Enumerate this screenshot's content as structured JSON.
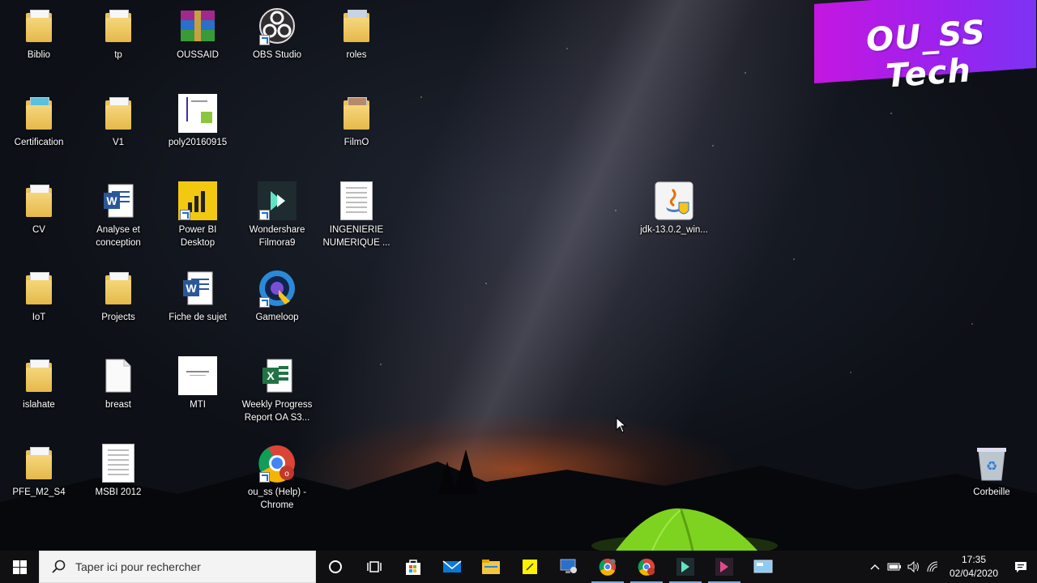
{
  "banner": {
    "text": "OU_SS Tech",
    "color_start": "#c417e0",
    "color_end": "#7c33f5"
  },
  "desktop": {
    "icons": [
      {
        "id": "biblio",
        "label": "Biblio",
        "type": "folder"
      },
      {
        "id": "certification",
        "label": "Certification",
        "type": "folder"
      },
      {
        "id": "cv",
        "label": "CV",
        "type": "folder"
      },
      {
        "id": "iot",
        "label": "IoT",
        "type": "folder"
      },
      {
        "id": "islahate",
        "label": "islahate",
        "type": "folder"
      },
      {
        "id": "pfe",
        "label": "PFE_M2_S4",
        "type": "folder"
      },
      {
        "id": "tp",
        "label": "tp",
        "type": "folder"
      },
      {
        "id": "v1",
        "label": "V1",
        "type": "folder"
      },
      {
        "id": "analyse",
        "label": "Analyse et conception",
        "type": "word"
      },
      {
        "id": "projects",
        "label": "Projects",
        "type": "folder"
      },
      {
        "id": "breast",
        "label": "breast",
        "type": "file"
      },
      {
        "id": "msbi",
        "label": "MSBI 2012",
        "type": "document"
      },
      {
        "id": "oussaid",
        "label": "OUSSAID",
        "type": "winrar"
      },
      {
        "id": "poly",
        "label": "poly20160915",
        "type": "document"
      },
      {
        "id": "powerbi",
        "label": "Power BI Desktop",
        "type": "powerbi"
      },
      {
        "id": "fiche",
        "label": "Fiche de sujet",
        "type": "word"
      },
      {
        "id": "mti",
        "label": "MTI",
        "type": "document"
      },
      {
        "id": "obs",
        "label": "OBS Studio",
        "type": "obs"
      },
      {
        "id": "filmora",
        "label": "Wondershare Filmora9",
        "type": "filmora"
      },
      {
        "id": "gameloop",
        "label": "Gameloop",
        "type": "gameloop"
      },
      {
        "id": "weekly",
        "label": "Weekly Progress Report OA S3...",
        "type": "excel"
      },
      {
        "id": "chrome",
        "label": "ou_ss (Help) - Chrome",
        "type": "chrome"
      },
      {
        "id": "roles",
        "label": "roles",
        "type": "folder"
      },
      {
        "id": "filmo",
        "label": "FilmO",
        "type": "folder"
      },
      {
        "id": "ingenierie",
        "label": "INGENIERIE NUMERIQUE ...",
        "type": "document"
      },
      {
        "id": "jdk",
        "label": "jdk-13.0.2_win...",
        "type": "java"
      },
      {
        "id": "corbeille",
        "label": "Corbeille",
        "type": "recycle"
      }
    ]
  },
  "taskbar": {
    "search_placeholder": "Taper ici pour rechercher",
    "apps": [
      "cortana-icon",
      "task-view-icon",
      "store-icon",
      "mail-icon",
      "file-explorer-icon",
      "sticky-notes-icon",
      "remote-desktop-icon",
      "chrome-icon",
      "chrome-profile-icon",
      "filmora-icon",
      "filmora-scrn-icon",
      "monitor-app-icon"
    ],
    "time": "17:35",
    "date": "02/04/2020"
  }
}
